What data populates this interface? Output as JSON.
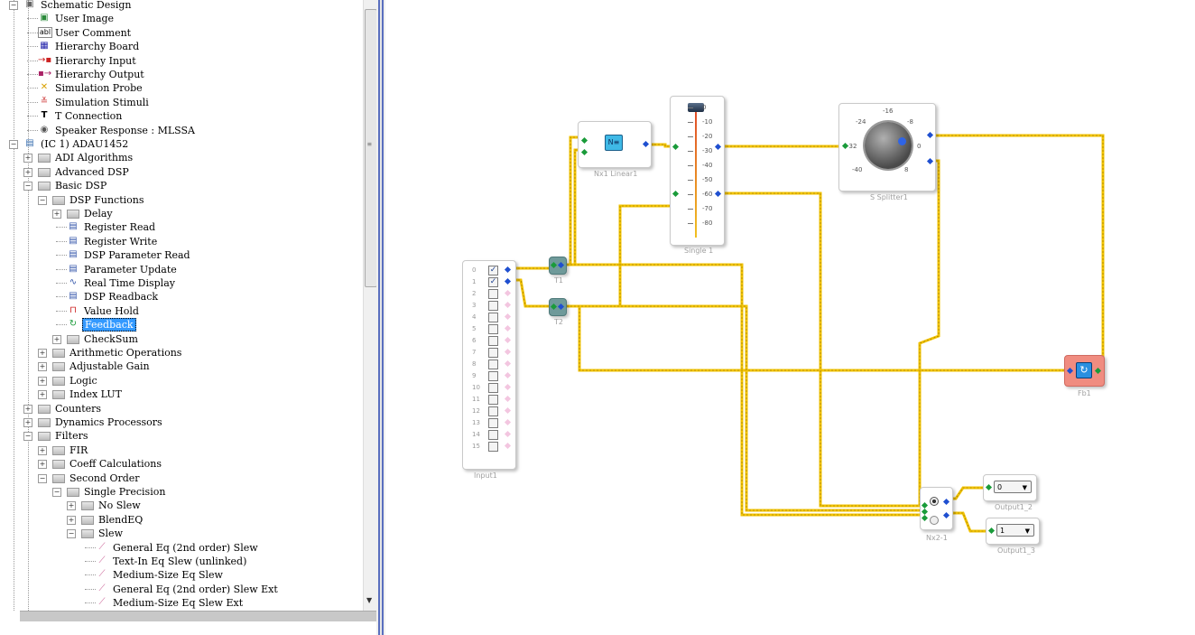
{
  "tree": {
    "items": [
      {
        "label": "Schematic Design",
        "icon": "schematic-icon",
        "expanded": true
      },
      {
        "label": "User Image",
        "icon": "image-icon"
      },
      {
        "label": "User Comment",
        "icon": "comment-icon",
        "icon_text": "abl"
      },
      {
        "label": "Hierarchy Board",
        "icon": "hierarchy-board-icon"
      },
      {
        "label": "Hierarchy Input",
        "icon": "hierarchy-input-icon"
      },
      {
        "label": "Hierarchy Output",
        "icon": "hierarchy-output-icon"
      },
      {
        "label": "Simulation Probe",
        "icon": "probe-icon"
      },
      {
        "label": "Simulation Stimuli",
        "icon": "stimuli-icon"
      },
      {
        "label": "T Connection",
        "icon": "t-connection-icon",
        "icon_text": "T"
      },
      {
        "label": "Speaker Response : MLSSA",
        "icon": "speaker-icon"
      },
      {
        "label": "(IC 1) ADAU1452",
        "icon": "chip-icon",
        "expanded": true
      },
      {
        "label": "ADI Algorithms",
        "icon": "folder-icon",
        "expanded": false
      },
      {
        "label": "Advanced DSP",
        "icon": "folder-icon",
        "expanded": false
      },
      {
        "label": "Basic DSP",
        "icon": "folder-icon",
        "expanded": true
      },
      {
        "label": "DSP Functions",
        "icon": "folder-icon",
        "expanded": true
      },
      {
        "label": "Delay",
        "icon": "folder-icon",
        "expanded": false
      },
      {
        "label": "Register Read",
        "icon": "register-icon"
      },
      {
        "label": "Register Write",
        "icon": "register-icon"
      },
      {
        "label": "DSP Parameter Read",
        "icon": "register-icon"
      },
      {
        "label": "Parameter Update",
        "icon": "register-icon"
      },
      {
        "label": "Real Time Display",
        "icon": "display-icon"
      },
      {
        "label": "DSP Readback",
        "icon": "register-icon"
      },
      {
        "label": "Value Hold",
        "icon": "hold-icon"
      },
      {
        "label": "Feedback",
        "icon": "feedback-icon",
        "selected": true
      },
      {
        "label": "CheckSum",
        "icon": "folder-icon",
        "expanded": false
      },
      {
        "label": "Arithmetic Operations",
        "icon": "folder-icon",
        "expanded": false
      },
      {
        "label": "Adjustable Gain",
        "icon": "folder-icon",
        "expanded": false
      },
      {
        "label": "Logic",
        "icon": "folder-icon",
        "expanded": false
      },
      {
        "label": "Index LUT",
        "icon": "folder-icon",
        "expanded": false
      },
      {
        "label": "Counters",
        "icon": "folder-icon",
        "expanded": false
      },
      {
        "label": "Dynamics Processors",
        "icon": "folder-icon",
        "expanded": false
      },
      {
        "label": "Filters",
        "icon": "folder-icon",
        "expanded": true
      },
      {
        "label": "FIR",
        "icon": "folder-icon",
        "expanded": false
      },
      {
        "label": "Coeff Calculations",
        "icon": "folder-icon",
        "expanded": false
      },
      {
        "label": "Second Order",
        "icon": "folder-icon",
        "expanded": true
      },
      {
        "label": "Single Precision",
        "icon": "folder-icon",
        "expanded": true
      },
      {
        "label": "No Slew",
        "icon": "folder-icon",
        "expanded": false
      },
      {
        "label": "BlendEQ",
        "icon": "folder-icon",
        "expanded": false
      },
      {
        "label": "Slew",
        "icon": "folder-icon",
        "expanded": true
      },
      {
        "label": "General Eq (2nd order) Slew",
        "icon": "eq-icon"
      },
      {
        "label": "Text-In Eq Slew (unlinked)",
        "icon": "eq-icon"
      },
      {
        "label": "Medium-Size Eq Slew",
        "icon": "eq-icon"
      },
      {
        "label": "General Eq (2nd order) Slew Ext",
        "icon": "eq-icon"
      },
      {
        "label": "Medium-Size Eq Slew Ext",
        "icon": "eq-icon"
      }
    ]
  },
  "schematic": {
    "wire_color": "#f2c300",
    "input_block": {
      "label": "Input1",
      "channels": [
        "0",
        "1",
        "2",
        "3",
        "4",
        "5",
        "6",
        "7",
        "8",
        "9",
        "10",
        "11",
        "12",
        "13",
        "14",
        "15"
      ],
      "checked": [
        true,
        true,
        false,
        false,
        false,
        false,
        false,
        false,
        false,
        false,
        false,
        false,
        false,
        false,
        false,
        false
      ]
    },
    "t1": {
      "label": "T1"
    },
    "t2": {
      "label": "T2"
    },
    "nx1": {
      "label": "Nx1 Linear1"
    },
    "single1": {
      "label": "Single 1",
      "ticks": [
        "0",
        "-10",
        "-20",
        "-30",
        "-40",
        "-50",
        "-60",
        "-70",
        "-80"
      ]
    },
    "splitter": {
      "label": "S Splitter1",
      "knob_ticks": [
        "-24",
        "-16",
        "-8",
        "-32",
        "0",
        "-40",
        "8"
      ]
    },
    "fb1": {
      "label": "Fb1",
      "color": "#f08c80"
    },
    "nx2": {
      "label": "Nx2-1"
    },
    "output1_2": {
      "label": "Output1_2",
      "value": "0"
    },
    "output1_3": {
      "label": "Output1_3",
      "value": "1"
    }
  }
}
